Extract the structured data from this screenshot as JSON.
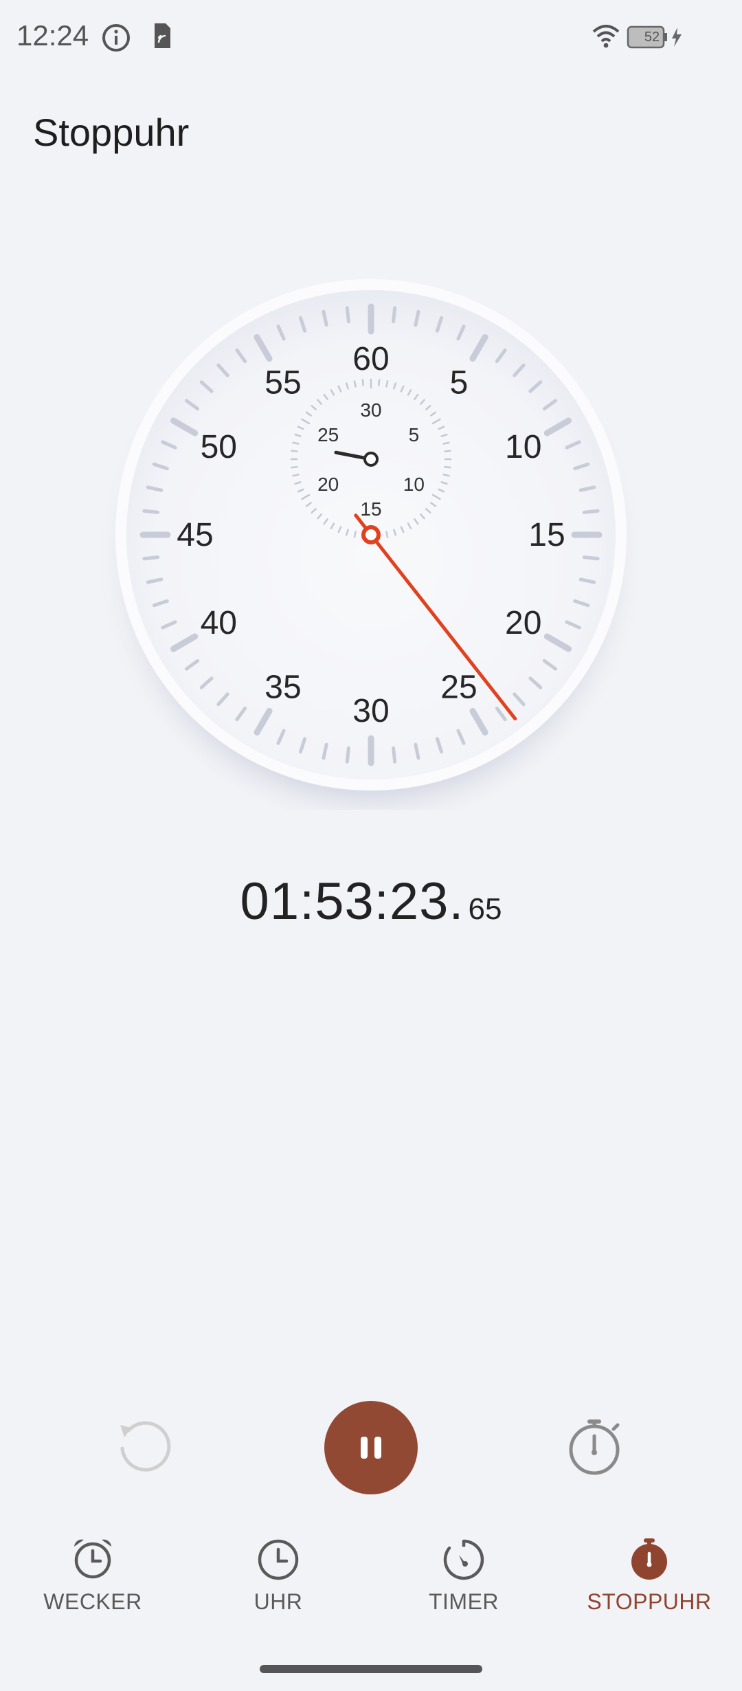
{
  "status_bar": {
    "time": "12:24",
    "battery_level": "52",
    "icons": [
      "info-icon",
      "sim-card-icon",
      "wifi-icon",
      "battery-charging-icon"
    ]
  },
  "title": "Stoppuhr",
  "dial": {
    "outer_labels": [
      "60",
      "5",
      "10",
      "15",
      "20",
      "25",
      "30",
      "35",
      "40",
      "45",
      "50",
      "55"
    ],
    "inner_labels": [
      "30",
      "5",
      "10",
      "15",
      "20",
      "25"
    ],
    "second_hand_seconds": 23.65,
    "minute_hand_minutes": 23.4,
    "accent_color": "#e0421f"
  },
  "elapsed": {
    "main": "01:53:23.",
    "centiseconds": "65"
  },
  "controls": {
    "reset_icon": "reset-icon",
    "pause_icon": "pause-icon",
    "lap_icon": "stopwatch-lap-icon",
    "pause_color": "#924934"
  },
  "nav": {
    "tabs": [
      {
        "label": "WECKER",
        "icon": "alarm-clock-icon",
        "active": false
      },
      {
        "label": "UHR",
        "icon": "clock-icon",
        "active": false
      },
      {
        "label": "TIMER",
        "icon": "timer-icon",
        "active": false
      },
      {
        "label": "STOPPUHR",
        "icon": "stopwatch-icon",
        "active": true
      }
    ],
    "active_color": "#8f4430"
  }
}
